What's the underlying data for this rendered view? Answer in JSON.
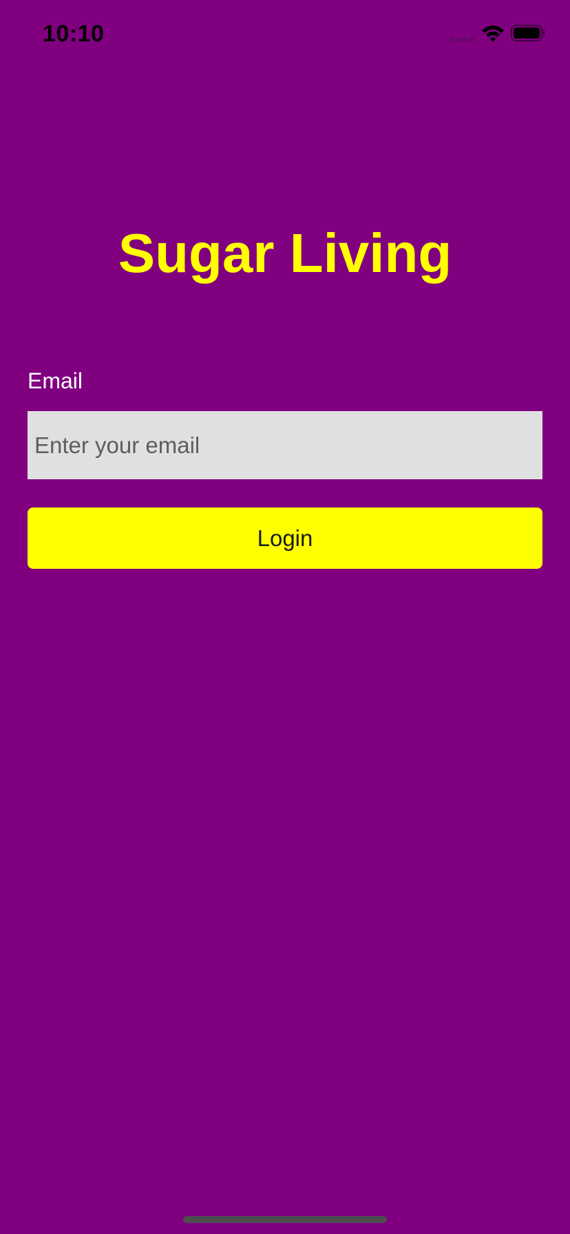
{
  "status_bar": {
    "time": "10:10",
    "icons": [
      "cellular-signal-icon",
      "wifi-icon",
      "battery-icon"
    ]
  },
  "app": {
    "title": "Sugar Living"
  },
  "login_form": {
    "email_label": "Email",
    "email_value": "",
    "email_placeholder": "Enter your email",
    "login_label": "Login"
  },
  "colors": {
    "background": "#800080",
    "title": "#ffff00",
    "button_background": "#ffff00",
    "input_background": "#e0e0e0",
    "label": "#ffffff"
  }
}
